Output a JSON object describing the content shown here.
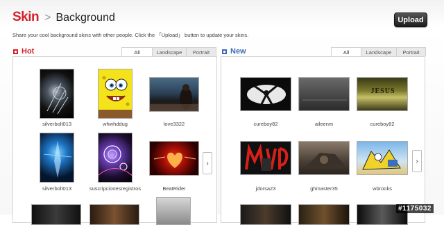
{
  "header": {
    "skin": "Skin",
    "separator": ">",
    "title": "Background",
    "upload_label": "Upload",
    "description": "Share your cool background skins with other people. Click the 「Upload」 button to update your skins."
  },
  "hot": {
    "title": "Hot",
    "tabs": [
      "All",
      "Landscape",
      "Portrait"
    ],
    "active_tab": "All",
    "items": [
      {
        "caption": "silverbolt013"
      },
      {
        "caption": "whwhddug"
      },
      {
        "caption": "love3322"
      },
      {
        "caption": "silverbolt013"
      },
      {
        "caption": "suscripcionesregistros"
      },
      {
        "caption": "BeatRider"
      }
    ]
  },
  "new": {
    "title": "New",
    "tabs": [
      "All",
      "Landscape",
      "Portrait"
    ],
    "active_tab": "All",
    "items": [
      {
        "caption": "cureboy82",
        "thumb_text": ""
      },
      {
        "caption": "aileenm",
        "thumb_text": ""
      },
      {
        "caption": "cureboy82",
        "thumb_text": "JESUS"
      },
      {
        "caption": "jdorsa23",
        "thumb_text": ""
      },
      {
        "caption": "ghmaster35",
        "thumb_text": ""
      },
      {
        "caption": "wbrooks",
        "thumb_text": ""
      }
    ]
  },
  "next_arrow": "›",
  "watermark": "#1175032",
  "colors": {
    "accent_red": "#d6202a",
    "accent_blue": "#3d6bb5",
    "button_dark": "#222222"
  }
}
